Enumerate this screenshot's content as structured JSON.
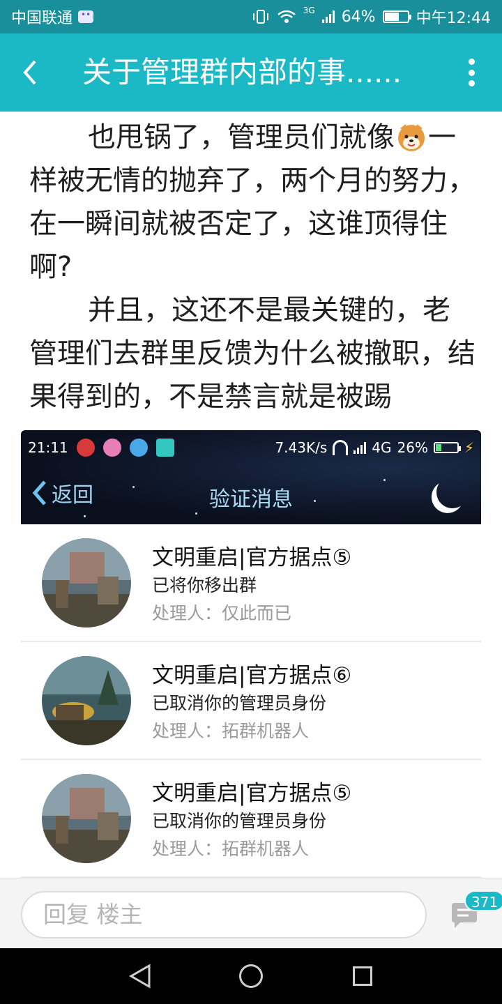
{
  "status_bar": {
    "carrier": "中国联通",
    "battery": "64%",
    "network": "3G",
    "time": "中午12:44"
  },
  "header": {
    "title": "关于管理群内部的事......"
  },
  "article": {
    "paragraphs": [
      {
        "before": "也甩锅了，管理员们就像",
        "after": "一样被无情的抛弃了，两个月的努力，在一瞬间就被否定了，这谁顶得住啊?"
      },
      {
        "text": "并且，这还不是最关键的，老管理们去群里反馈为什么被撤职，结果得到的，不是禁言就是被踢"
      }
    ]
  },
  "embedded_screenshot": {
    "status": {
      "time": "21:11",
      "speed": "7.43K/s",
      "network": "4G",
      "battery": "26%"
    },
    "nav": {
      "back_label": "返回",
      "title": "验证消息"
    },
    "messages": [
      {
        "group": "文明重启|官方据点⑤",
        "action": "已将你移出群",
        "handler": "处理人：仅此而已"
      },
      {
        "group": "文明重启|官方据点⑥",
        "action": "已取消你的管理员身份",
        "handler": "处理人：拓群机器人"
      },
      {
        "group": "文明重启|官方据点⑤",
        "action": "已取消你的管理员身份",
        "handler": "处理人：拓群机器人"
      }
    ]
  },
  "reply_bar": {
    "placeholder": "回复  楼主",
    "comment_count": "371"
  },
  "colors": {
    "header": "#1bb8c6",
    "status_bar": "#1a8f9c",
    "badge": "#1bb8c6"
  }
}
